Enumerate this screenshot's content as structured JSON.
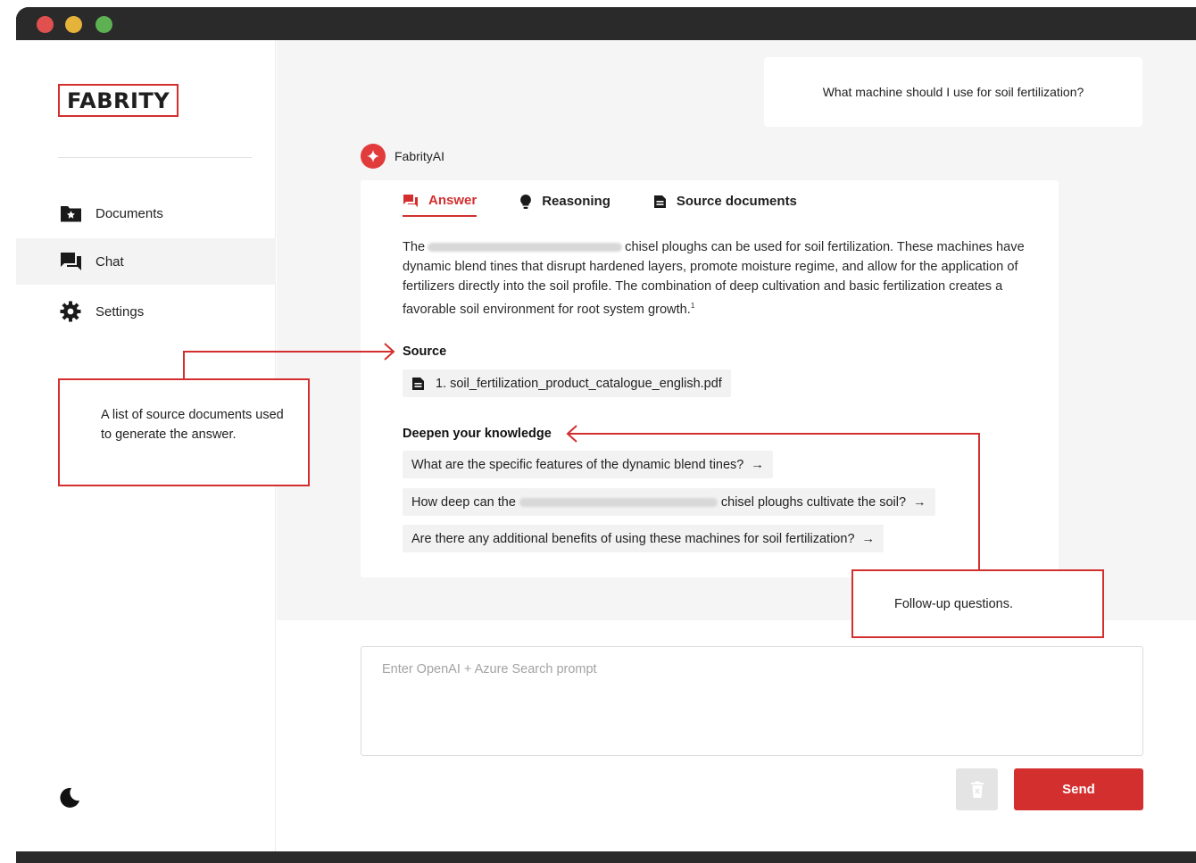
{
  "app": {
    "logo": "FABRITY",
    "colors": {
      "accent": "#d32f2f",
      "window_chrome": "#2a2a2a",
      "main_bg": "#f5f5f5"
    }
  },
  "sidebar": {
    "items": [
      {
        "label": "Documents",
        "icon": "folder-star-icon",
        "active": false
      },
      {
        "label": "Chat",
        "icon": "chat-bubbles-icon",
        "active": true
      },
      {
        "label": "Settings",
        "icon": "gear-icon",
        "active": false
      }
    ],
    "theme_icon": "moon-icon"
  },
  "chat": {
    "user_message": "What machine should I use for soil fertilization?",
    "assistant_name": "FabrityAI",
    "tabs": [
      {
        "label": "Answer",
        "icon": "chat-icon",
        "active": true
      },
      {
        "label": "Reasoning",
        "icon": "lightbulb-icon",
        "active": false
      },
      {
        "label": "Source documents",
        "icon": "document-icon",
        "active": false
      }
    ],
    "answer_prefix": "The",
    "answer_body": "chisel ploughs can be used for soil fertilization. These machines have dynamic blend tines that disrupt hardened layers, promote moisture regime, and allow for the application of fertilizers directly into the soil profile. The combination of deep cultivation and basic fertilization creates a favorable soil environment for root system growth.",
    "citation": "1",
    "source_heading": "Source",
    "sources": [
      "1. soil_fertilization_product_catalogue_english.pdf"
    ],
    "followup_heading": "Deepen your knowledge",
    "followups": [
      {
        "pre": "What are the specific features of the dynamic blend tines?",
        "post": ""
      },
      {
        "pre": "How deep can the",
        "post": "chisel ploughs cultivate the soil?"
      },
      {
        "pre": "Are there any additional benefits of using these machines for soil fertilization?",
        "post": ""
      }
    ],
    "arrow": "→"
  },
  "composer": {
    "placeholder": "Enter OpenAI + Azure Search prompt",
    "value": "",
    "send_label": "Send",
    "clear_icon": "trash-icon"
  },
  "annotations": {
    "sources_note": "A list of source documents used to generate the answer.",
    "followup_note": "Follow-up questions."
  }
}
